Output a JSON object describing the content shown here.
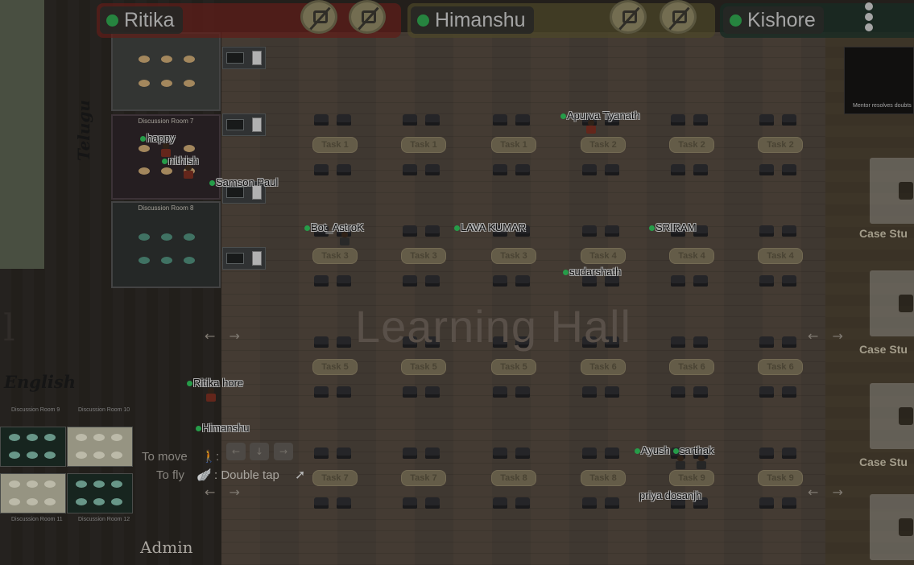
{
  "participants": [
    {
      "name": "Ritika"
    },
    {
      "name": "Himanshu"
    },
    {
      "name": "Kishore"
    }
  ],
  "rooms": {
    "left_language_top": "Telugu",
    "left_language_bottom": "English",
    "room2_caption": "Discussion Room 7",
    "room3_caption": "Discussion Room 8",
    "english_caps": [
      "Discussion Room 9",
      "Discussion Room 10",
      "Discussion Room 11",
      "Discussion Room 12"
    ]
  },
  "hall": {
    "title": "Learning Hall",
    "task_rows": [
      [
        "Task 1",
        "Task 1",
        "Task 1",
        "Task 2",
        "Task 2",
        "Task 2"
      ],
      [
        "Task 3",
        "Task 3",
        "Task 3",
        "Task 4",
        "Task 4",
        "Task 4"
      ],
      [
        "Task 5",
        "Task 5",
        "Task 5",
        "Task 6",
        "Task 6",
        "Task 6"
      ],
      [
        "Task 7",
        "Task 7",
        "Task 8",
        "Task 8",
        "Task 9",
        "Task 9"
      ]
    ]
  },
  "case_study_label": "Case Stu",
  "mentor_note": "Mentor resolves doubts",
  "players": {
    "happy": "happy",
    "nithish": "nithish",
    "samson": "Samson Paul",
    "bot": "Bot_AstroK",
    "lava": "LAVA KUMAR",
    "apurva": "Apurva Tyanath",
    "sriram": "SRIRAM",
    "sudarshan": "sudarshath",
    "ritika": "Ritika hore",
    "himanshu": "Himanshu",
    "ayush": "Ayush",
    "sarthak": "sarthak",
    "priya": "priya dosanjh"
  },
  "controls": {
    "move_label": "To move",
    "fly_label": "To fly",
    "fly_hint": ": Double tap"
  },
  "admin_label": "Admin"
}
